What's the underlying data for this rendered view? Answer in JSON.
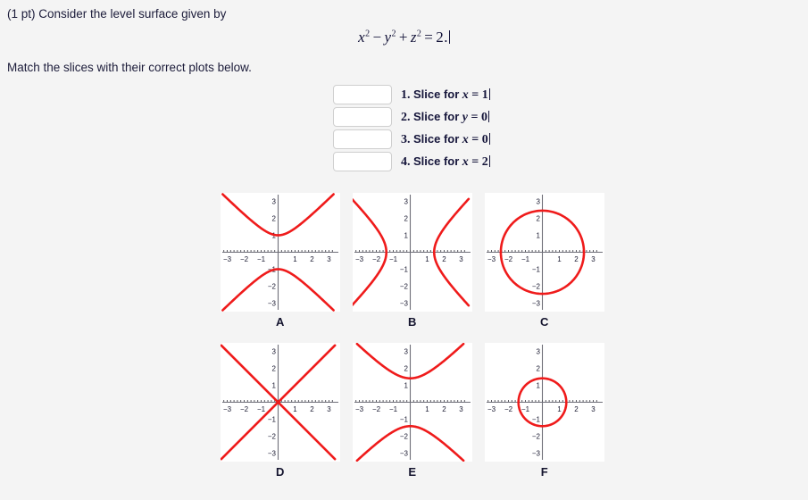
{
  "prompt": {
    "intro": "(1 pt) Consider the level surface given by",
    "instruction": "Match the slices with their correct plots below.",
    "equation": {
      "lhs_x": "x",
      "lhs_x_pow": "2",
      "minus": "−",
      "lhs_y": "y",
      "lhs_y_pow": "2",
      "plus": "+",
      "lhs_z": "z",
      "lhs_z_pow": "2",
      "equals": "=",
      "rhs": "2.",
      "plain": "x² − y² + z² = 2."
    }
  },
  "answers": {
    "placeholder": "",
    "items": [
      {
        "number": "1.",
        "slice_word": "Slice for",
        "variable": "x",
        "equals": "=",
        "value": "1",
        "value_entered": "",
        "plain": "1. Slice for x = 1"
      },
      {
        "number": "2.",
        "slice_word": "Slice for",
        "variable": "y",
        "equals": "=",
        "value": "0",
        "value_entered": "",
        "plain": "2. Slice for y = 0"
      },
      {
        "number": "3.",
        "slice_word": "Slice for",
        "variable": "x",
        "equals": "=",
        "value": "0",
        "value_entered": "",
        "plain": "3. Slice for x = 0"
      },
      {
        "number": "4.",
        "slice_word": "Slice for",
        "variable": "x",
        "equals": "=",
        "value": "2",
        "value_entered": "",
        "plain": "4. Slice for x = 2"
      }
    ]
  },
  "plots": {
    "axis_ticks": [
      "-3",
      "-2",
      "-1",
      "1",
      "2",
      "3"
    ],
    "curve_color": "#ef1b1b",
    "axis_color": "#6e6e78",
    "items": [
      {
        "letter": "A",
        "shape": "hyperbola-vertical",
        "vertex": 1.0,
        "description": "Vertical hyperbola, branches open up and down, vertices at y = ±1"
      },
      {
        "letter": "B",
        "shape": "hyperbola-horizontal",
        "vertex": 1.41,
        "description": "Horizontal hyperbola, branches open left and right, vertices at x = ±√2"
      },
      {
        "letter": "C",
        "shape": "circle",
        "radius": 2.45,
        "description": "Circle of radius √6 ≈ 2.45 centered at origin"
      },
      {
        "letter": "D",
        "shape": "cross-lines",
        "slope": 1.0,
        "description": "Degenerate conic: pair of crossing lines y = ±x"
      },
      {
        "letter": "E",
        "shape": "hyperbola-vertical",
        "vertex": 1.41,
        "description": "Vertical hyperbola, branches open up and down, vertices at y = ±√2"
      },
      {
        "letter": "F",
        "shape": "circle",
        "radius": 1.41,
        "description": "Circle of radius √2 ≈ 1.41 centered at origin"
      }
    ]
  },
  "chart_data": {
    "type": "scatter",
    "title": "Slice plots of the level surface x² − y² + z² = 2",
    "xlabel": "",
    "ylabel": "",
    "xlim": [
      -3.4,
      3.4
    ],
    "ylim": [
      -3.4,
      3.4
    ],
    "grid": false,
    "legend": "none",
    "xticks": [
      -3,
      -2,
      -1,
      1,
      2,
      3
    ],
    "yticks": [
      -3,
      -2,
      -1,
      1,
      2,
      3
    ],
    "panels": [
      {
        "label": "A",
        "curve": "hyperbola",
        "axis": "vertical",
        "a": 1.0,
        "b": 1.0,
        "equation": "y² − x² = 1"
      },
      {
        "label": "B",
        "curve": "hyperbola",
        "axis": "horizontal",
        "a": 1.41,
        "b": 1.41,
        "equation": "x² − y² = 2"
      },
      {
        "label": "C",
        "curve": "circle",
        "radius": 2.45,
        "equation": "x² + y² = 6"
      },
      {
        "label": "D",
        "curve": "lines",
        "slopes": [
          1,
          -1
        ],
        "equation": "y² = x²"
      },
      {
        "label": "E",
        "curve": "hyperbola",
        "axis": "vertical",
        "a": 1.41,
        "b": 1.41,
        "equation": "y² − x² = 2"
      },
      {
        "label": "F",
        "curve": "circle",
        "radius": 1.41,
        "equation": "x² + y² = 2"
      }
    ]
  }
}
